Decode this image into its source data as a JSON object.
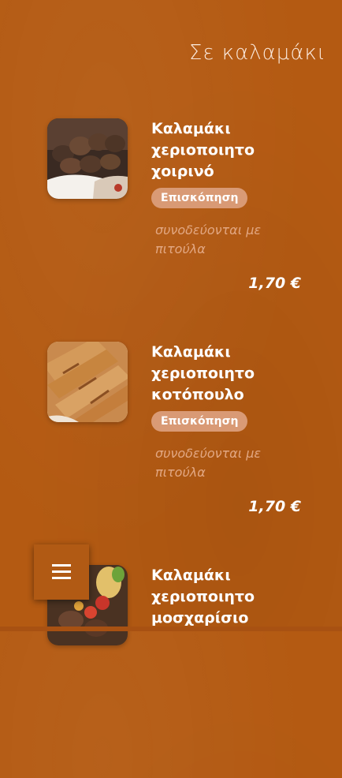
{
  "header": {
    "title": "Σε καλαμάκι"
  },
  "items": [
    {
      "name_line1": "Καλαμάκι",
      "name_line2": "χεριοποιητο",
      "name_line3": "χοιρινό",
      "overview_label": "Επισκόπηση",
      "desc_line1": "συνοδεύονται με",
      "desc_line2": "πιτούλα",
      "price": "1,70 €"
    },
    {
      "name_line1": "Καλαμάκι",
      "name_line2": "χεριοποιητο",
      "name_line3": "κοτόπουλο",
      "overview_label": "Επισκόπηση",
      "desc_line1": "συνοδεύονται με",
      "desc_line2": "πιτούλα",
      "price": "1,70 €"
    },
    {
      "name_line1": "Καλαμάκι",
      "name_line2": "χεριοποιητο",
      "name_line3": "μοσχαρίσιο"
    }
  ],
  "menu_button": {
    "icon": "hamburger-menu-icon"
  },
  "colors": {
    "background": "#b45a12",
    "accent_pill": "#d99a75",
    "desc_text": "#e2a782"
  }
}
